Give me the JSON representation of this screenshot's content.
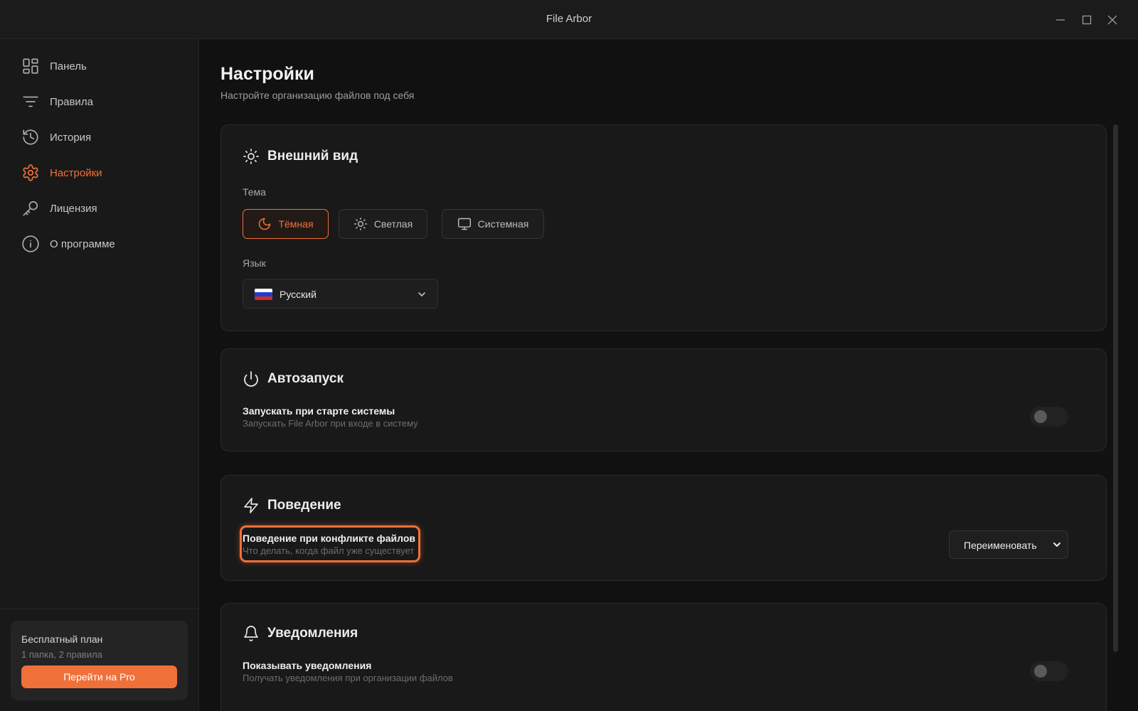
{
  "window": {
    "title": "File Arbor"
  },
  "sidebar": {
    "items": [
      {
        "label": "Панель",
        "icon": "grid-icon"
      },
      {
        "label": "Правила",
        "icon": "filter-icon"
      },
      {
        "label": "История",
        "icon": "history-icon"
      },
      {
        "label": "Настройки",
        "icon": "gear-icon",
        "active": true
      },
      {
        "label": "Лицензия",
        "icon": "key-icon"
      },
      {
        "label": "О программе",
        "icon": "info-icon"
      }
    ],
    "plan": {
      "title": "Бесплатный план",
      "subtitle": "1 папка, 2 правила",
      "button": "Перейти на Pro"
    }
  },
  "page": {
    "title": "Настройки",
    "subtitle": "Настройте организацию файлов под себя"
  },
  "appearance": {
    "title": "Внешний вид",
    "theme_label": "Тема",
    "themes": [
      {
        "label": "Тёмная",
        "icon": "moon-icon",
        "selected": true
      },
      {
        "label": "Светлая",
        "icon": "sun-icon",
        "selected": false
      },
      {
        "label": "Системная",
        "icon": "monitor-icon",
        "selected": false
      }
    ],
    "language_label": "Язык",
    "language_value": "Русский",
    "language_flag": "russian-flag"
  },
  "autostart": {
    "title": "Автозапуск",
    "setting_title": "Запускать при старте системы",
    "setting_desc": "Запускать File Arbor при входе в систему",
    "enabled": false
  },
  "behavior": {
    "title": "Поведение",
    "setting_title": "Поведение при конфликте файлов",
    "setting_desc": "Что делать, когда файл уже существует",
    "select_value": "Переименовать"
  },
  "notifications": {
    "title": "Уведомления",
    "setting_title": "Показывать уведомления",
    "setting_desc": "Получать уведомления при организации файлов",
    "enabled": false
  },
  "colors": {
    "accent": "#f0703a",
    "background": "#111111",
    "sidebar": "#191919",
    "card": "#191919"
  }
}
